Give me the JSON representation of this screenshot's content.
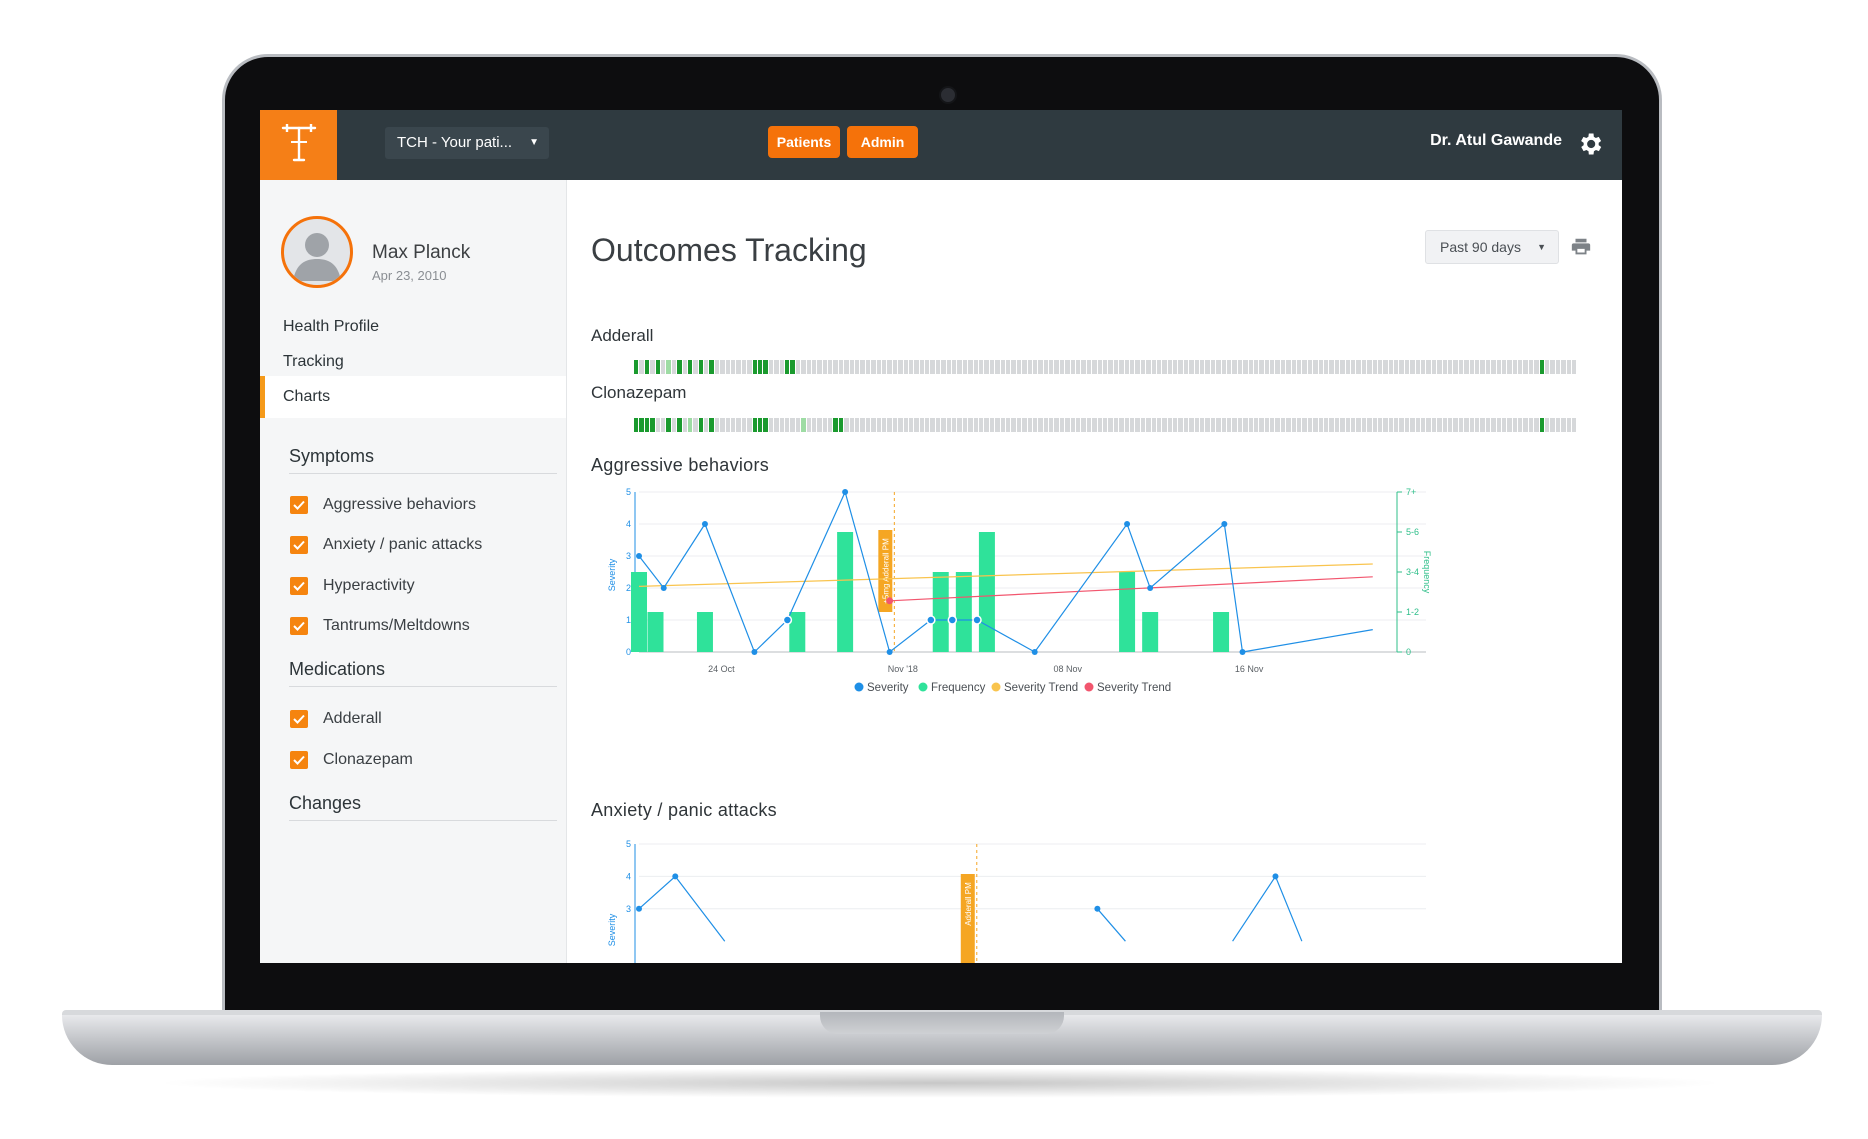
{
  "app": {
    "clinic_selector": "TCH - Your pati...",
    "nav_buttons": [
      "Patients",
      "Admin"
    ],
    "user": "Dr. Atul Gawande"
  },
  "patient": {
    "name": "Max Planck",
    "dob": "Apr 23, 2010"
  },
  "sidebar": {
    "nav": [
      "Health Profile",
      "Tracking",
      "Charts"
    ],
    "active_nav": "Charts",
    "symptoms_heading": "Symptoms",
    "symptoms": [
      "Aggressive behaviors",
      "Anxiety / panic attacks",
      "Hyperactivity",
      "Tantrums/Meltdowns"
    ],
    "medications_heading": "Medications",
    "medications": [
      "Adderall",
      "Clonazepam"
    ],
    "changes_heading": "Changes"
  },
  "main": {
    "title": "Outcomes Tracking",
    "range": "Past 90 days",
    "adherence": [
      {
        "name": "Adderall",
        "cells": "2020203020202020000000222000220000000000000000000000000000000000000000000000000000000000000000000000000000000000000000000000000000000000000000000000000000000000000000002000000"
      },
      {
        "name": "Clonazepam",
        "cells": "2222002020302020000000222000000300000220000000000000000000000000000000000000000000000000000000000000000000000000000000000000000000000000000000000000000000000000000000002000000"
      }
    ],
    "colors": {
      "accent": "#f5720a",
      "taken": "#1a9a2e",
      "partial": "#9edca4",
      "missed": "#d6d8da",
      "severity": "#1f8fe6",
      "frequency": "#2fe29a",
      "trend1": "#f9c44e",
      "trend2": "#f2566e"
    }
  },
  "chart_data": [
    {
      "type": "bar+line",
      "title": "Aggressive behaviors",
      "ylabel": "Severity",
      "y2label": "Frequency",
      "ylim": [
        0,
        5
      ],
      "yticks": [
        "0",
        "1",
        "2",
        "3",
        "4",
        "5"
      ],
      "y2ticks": [
        "0",
        "1-2",
        "3-4",
        "5-6",
        "7+"
      ],
      "x_tick_labels": [
        {
          "label": "24 Oct",
          "day": 5
        },
        {
          "label": "Nov '18",
          "day": 16
        },
        {
          "label": "08 Nov",
          "day": 26
        },
        {
          "label": "16 Nov",
          "day": 37
        }
      ],
      "x_range": [
        0,
        45
      ],
      "severity": [
        [
          0,
          3
        ],
        [
          1.5,
          2
        ],
        [
          4,
          4
        ],
        [
          7,
          0
        ],
        [
          9,
          1
        ],
        [
          12.5,
          5
        ],
        [
          15.2,
          0
        ],
        [
          17.7,
          1
        ],
        [
          19,
          1
        ],
        [
          20.5,
          1
        ],
        [
          24,
          0
        ],
        [
          29.6,
          4
        ],
        [
          31,
          2
        ],
        [
          35.5,
          4
        ],
        [
          36.6,
          0
        ],
        [
          44.5,
          0.7
        ]
      ],
      "frequency": [
        [
          0,
          2.5
        ],
        [
          1,
          1.25
        ],
        [
          4,
          1.25
        ],
        [
          9.6,
          1.25
        ],
        [
          12.5,
          3.75
        ],
        [
          18.3,
          2.5
        ],
        [
          19.7,
          2.5
        ],
        [
          21.1,
          3.75
        ],
        [
          29.6,
          2.5
        ],
        [
          31,
          1.25
        ],
        [
          35.3,
          1.25
        ]
      ],
      "severity_trend_1": [
        [
          0,
          2.05
        ],
        [
          44.5,
          2.75
        ]
      ],
      "severity_trend_2": [
        [
          15.2,
          1.6
        ],
        [
          44.5,
          2.35
        ]
      ],
      "red_point": [
        15.2,
        1.6
      ],
      "annotations": [
        {
          "label": "+5mg Adderall PM",
          "day": 15
        }
      ],
      "legend": [
        "Severity",
        "Frequency",
        "Severity Trend",
        "Severity Trend"
      ]
    },
    {
      "type": "line",
      "title": "Anxiety / panic attacks",
      "ylabel": "Severity",
      "ylim": [
        0,
        5
      ],
      "yticks": [
        "3",
        "4",
        "5"
      ],
      "x_range": [
        0,
        45
      ],
      "severity": [
        [
          0,
          3
        ],
        [
          2.2,
          4
        ],
        [
          5.2,
          2
        ],
        [
          27.8,
          3
        ],
        [
          29.5,
          2
        ],
        [
          36,
          2
        ],
        [
          38.6,
          4
        ],
        [
          40.2,
          2
        ]
      ],
      "annotations": [
        {
          "label": "Adderall PM",
          "day": 20
        }
      ]
    }
  ]
}
